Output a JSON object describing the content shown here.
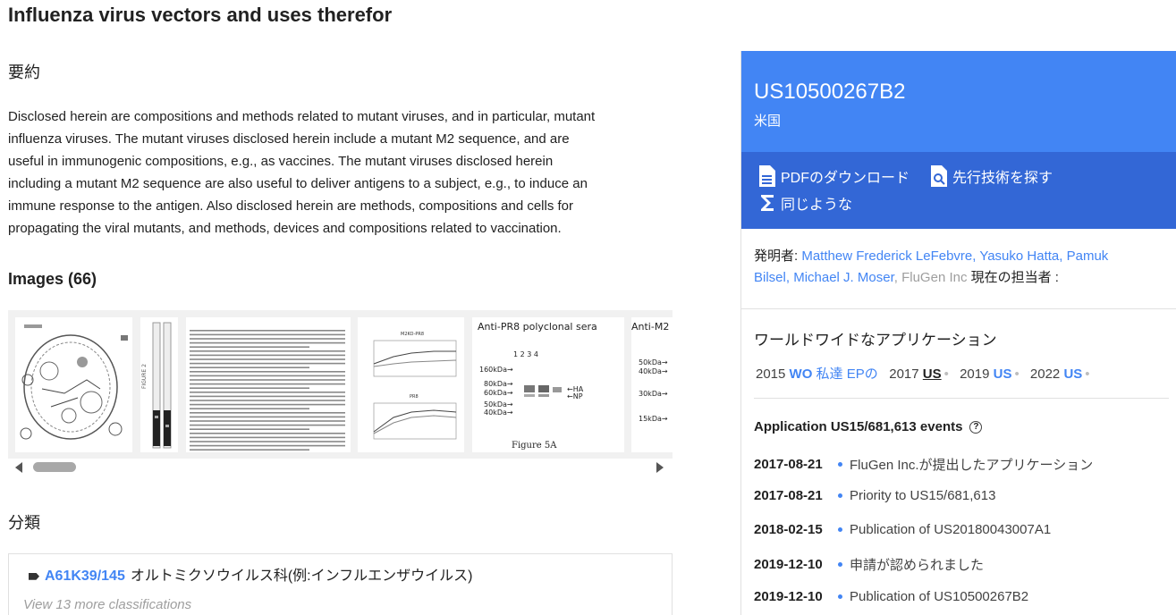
{
  "title": "Influenza virus vectors and uses therefor",
  "abstract": {
    "heading": "要約",
    "lines": [
      "Disclosed herein are compositions and methods related to mutant viruses, and in particular, mutant",
      "influenza viruses. The mutant viruses disclosed herein include a mutant M2 sequence, and are",
      "useful in immunogenic compositions, e.g., as vaccines. The mutant viruses disclosed herein",
      "including a mutant M2 sequence are also useful to deliver antigens to a subject, e.g., to induce an",
      "immune response to the antigen. Also disclosed herein are methods, compositions and cells for",
      "propagating the viral mutants, and methods, devices and compositions related to vaccination."
    ]
  },
  "images": {
    "heading": "Images (66)",
    "thumb_texts": {
      "fig2": "FIGURE 2",
      "fig5a_title": "Anti-PR8 polyclonal sera",
      "fig5a_caption": "Figure 5A",
      "fig5a_lanes": "1   2   3   4",
      "fig5a_markers": [
        "160kDa→",
        "80kDa→",
        "60kDa→",
        "50kDa→",
        "40kDa→"
      ],
      "fig5a_labels": [
        "←HA",
        "←NP"
      ],
      "next_title": "Anti-M2",
      "next_markers": [
        "50kDa→",
        "40kDa→",
        "30kDa→",
        "15kDa→"
      ],
      "chart_top": "M2KO-PR8",
      "chart_bottom": "PR8"
    }
  },
  "classification": {
    "heading": "分類",
    "code": "A61K39/145",
    "description": "オルトミクソウイルス科(例:インフルエンザウイルス)",
    "more": "View 13 more classifications"
  },
  "sidebar": {
    "pub_number": "US10500267B2",
    "country": "米国",
    "actions": {
      "pdf": "PDFのダウンロード",
      "prior_art": "先行技術を探す",
      "similar": "同じような"
    },
    "inventors_label": "発明者:",
    "inventors": [
      "Matthew Frederick LeFebvre",
      "Yasuko Hatta",
      "Pamuk Bilsel",
      "Michael J. Moser"
    ],
    "assignee_original": "FluGen Inc",
    "current_assignee_label": "現在の担当者 :",
    "worldwide": {
      "title": "ワールドワイドなアプリケーション",
      "entries": [
        {
          "year": "2015",
          "country": "WO"
        },
        {
          "year": "",
          "country": "私達 EPの"
        },
        {
          "year": "2017",
          "country": "US"
        },
        {
          "year": "2019",
          "country": "US"
        },
        {
          "year": "2022",
          "country": "US"
        }
      ]
    },
    "events": {
      "title": "Application US15/681,613 events",
      "help": "?",
      "items": [
        {
          "date": "2017-08-21",
          "desc": "FluGen Inc.が提出したアプリケーション"
        },
        {
          "date": "2017-08-21",
          "desc": "Priority to US15/681,613"
        },
        {
          "date": "2018-02-15",
          "desc": "Publication of US20180043007A1"
        },
        {
          "date": "2019-12-10",
          "desc": "申請が認められました"
        },
        {
          "date": "2019-12-10",
          "desc": "Publication of US10500267B2"
        }
      ]
    }
  }
}
